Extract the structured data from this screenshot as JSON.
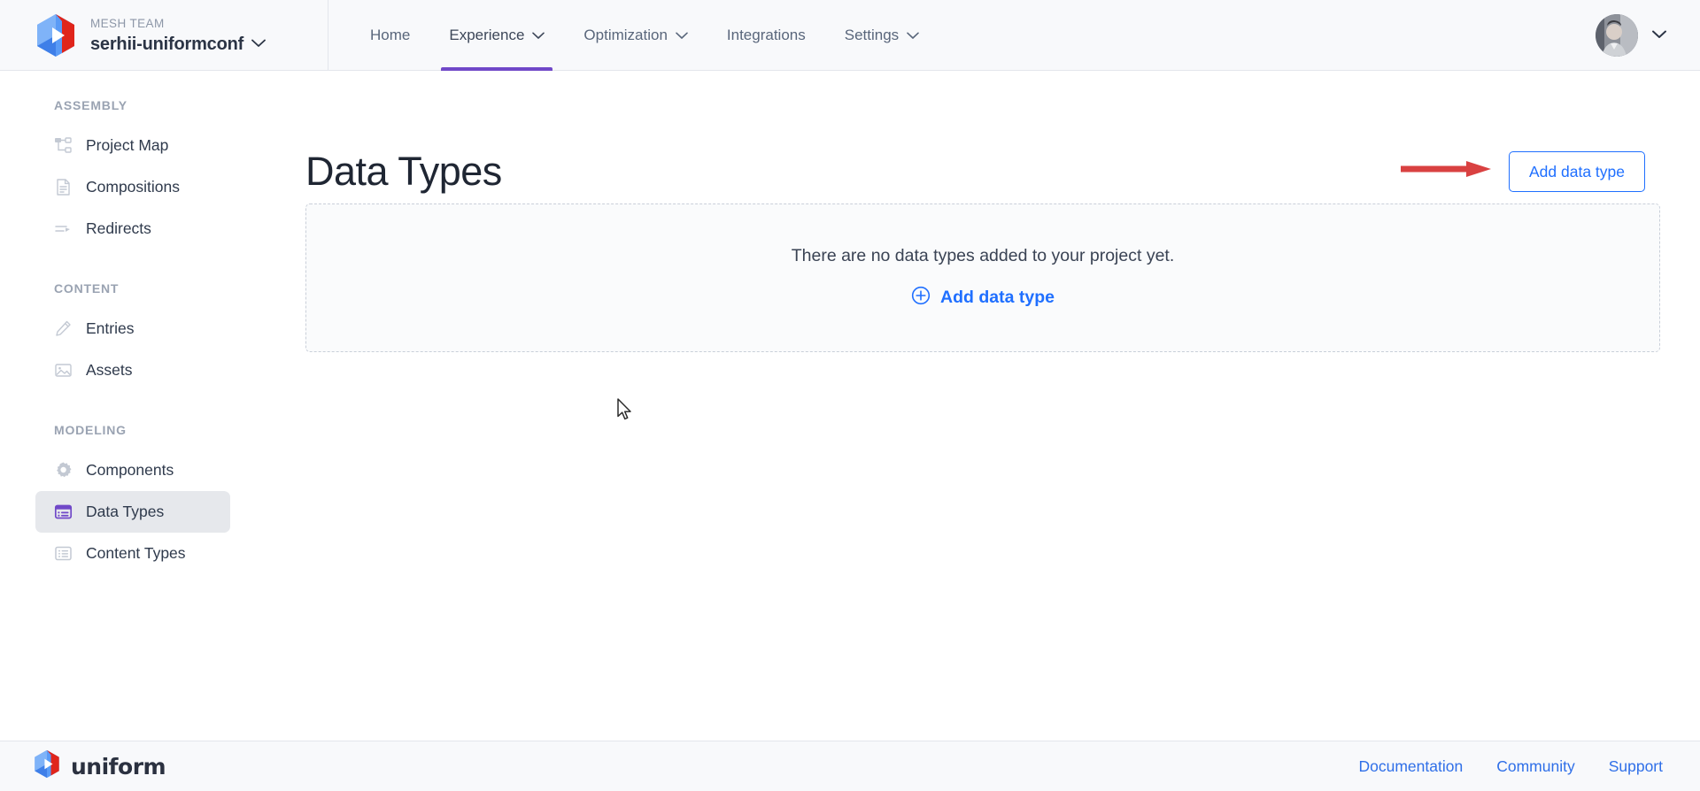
{
  "brand": {
    "team_label": "MESH TEAM",
    "project_name": "serhii-uniformconf",
    "logo_icon": "uniform-hex-logo",
    "project_chevron_icon": "chevron-down-icon"
  },
  "topnav": {
    "items": [
      {
        "label": "Home",
        "has_caret": false,
        "active": false
      },
      {
        "label": "Experience",
        "has_caret": true,
        "active": true
      },
      {
        "label": "Optimization",
        "has_caret": true,
        "active": false
      },
      {
        "label": "Integrations",
        "has_caret": false,
        "active": false
      },
      {
        "label": "Settings",
        "has_caret": true,
        "active": false
      }
    ],
    "active_underline_color": "#7048c8"
  },
  "user": {
    "avatar_icon": "user-avatar",
    "menu_chevron_icon": "chevron-down-icon"
  },
  "sidebar": {
    "groups": [
      {
        "label": "ASSEMBLY",
        "items": [
          {
            "label": "Project Map",
            "icon": "sitemap-icon",
            "selected": false
          },
          {
            "label": "Compositions",
            "icon": "document-icon",
            "selected": false
          },
          {
            "label": "Redirects",
            "icon": "arrow-redirect-icon",
            "selected": false
          }
        ]
      },
      {
        "label": "CONTENT",
        "items": [
          {
            "label": "Entries",
            "icon": "pencil-icon",
            "selected": false
          },
          {
            "label": "Assets",
            "icon": "image-icon",
            "selected": false
          }
        ]
      },
      {
        "label": "MODELING",
        "items": [
          {
            "label": "Components",
            "icon": "gear-icon",
            "selected": false
          },
          {
            "label": "Data Types",
            "icon": "database-rows-icon",
            "selected": true
          },
          {
            "label": "Content Types",
            "icon": "list-icon",
            "selected": false
          }
        ]
      }
    ],
    "selected_bg": "#e6e8ec",
    "selected_icon_color": "#7048c8"
  },
  "main": {
    "page_title": "Data Types",
    "add_button_label": "Add data type",
    "annotation_arrow_color": "#d94141",
    "empty_state": {
      "message": "There are no data types added to your project yet.",
      "link_label": "Add data type",
      "link_icon": "plus-circle-icon"
    }
  },
  "footer": {
    "wordmark": "uniform",
    "logo_icon": "uniform-hex-logo",
    "links": [
      {
        "label": "Documentation"
      },
      {
        "label": "Community"
      },
      {
        "label": "Support"
      }
    ],
    "link_color": "#2f6fe8"
  },
  "cursor": {
    "icon": "mouse-pointer-icon"
  }
}
